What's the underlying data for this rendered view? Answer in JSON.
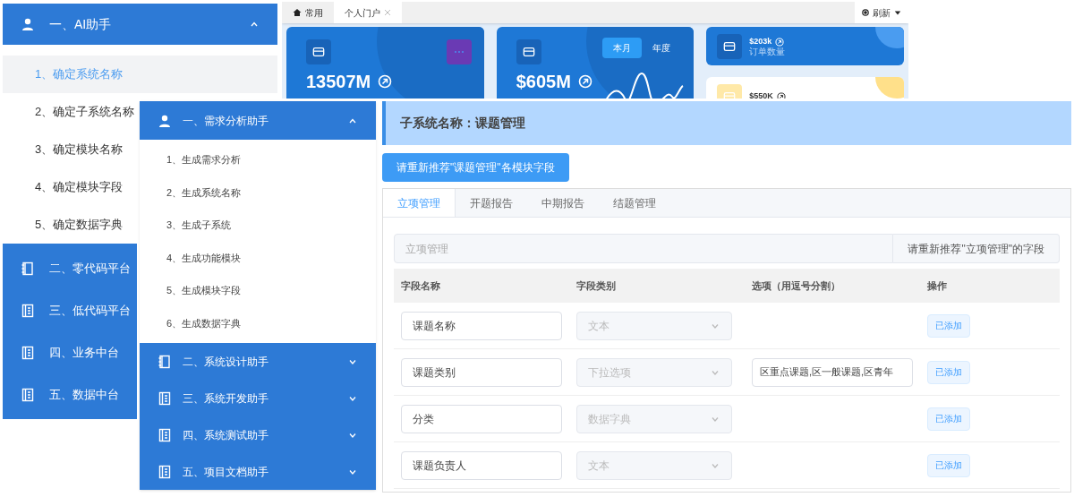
{
  "ai_menu": {
    "header": {
      "label": "一、AI助手",
      "expanded": true
    },
    "items": [
      {
        "label": "1、确定系统名称",
        "selected": true
      },
      {
        "label": "2、确定子系统名称",
        "selected": false
      },
      {
        "label": "3、确定模块名称",
        "selected": false
      },
      {
        "label": "4、确定模块字段",
        "selected": false
      },
      {
        "label": "5、确定数据字典",
        "selected": false
      }
    ],
    "sections": [
      {
        "label": "二、零代码平台",
        "kind": "notebook"
      },
      {
        "label": "三、低代码平台",
        "kind": "ledger"
      },
      {
        "label": "四、业务中台",
        "kind": "ledger"
      },
      {
        "label": "五、数据中台",
        "kind": "ledger"
      }
    ]
  },
  "dashboard": {
    "tabs": [
      {
        "label": "常用",
        "selected": false,
        "closable": false
      },
      {
        "label": "个人门户",
        "selected": true,
        "closable": true
      }
    ],
    "refresh": "刷新",
    "cards": [
      {
        "value": "13507M",
        "kind": "menu"
      },
      {
        "value": "$605M",
        "kind": "periods",
        "periods": [
          {
            "label": "本月",
            "selected": true
          },
          {
            "label": "年度",
            "selected": false
          }
        ]
      }
    ],
    "stats": [
      {
        "value": "$203k",
        "label": "订单数量",
        "kind": "blue"
      },
      {
        "value": "$550K",
        "kind": "white"
      }
    ]
  },
  "assistant_menu": {
    "header": {
      "label": "一、需求分析助手",
      "expanded": true
    },
    "items": [
      "1、生成需求分析",
      "2、生成系统名称",
      "3、生成子系统",
      "4、生成功能模块",
      "5、生成模块字段",
      "6、生成数据字典"
    ],
    "sections": [
      {
        "label": "二、系统设计助手",
        "kind": "notebook",
        "expanded": false
      },
      {
        "label": "三、系统开发助手",
        "kind": "ledger",
        "expanded": false
      },
      {
        "label": "四、系统测试助手",
        "kind": "ledger",
        "expanded": false
      },
      {
        "label": "五、项目文档助手",
        "kind": "ledger",
        "expanded": false
      }
    ]
  },
  "module_editor": {
    "title": "子系统名称：课题管理",
    "recommend_button": "请重新推荐\"课题管理\"各模块字段",
    "tabs": [
      {
        "label": "立项管理",
        "selected": true
      },
      {
        "label": "开题报告",
        "selected": false
      },
      {
        "label": "中期报告",
        "selected": false
      },
      {
        "label": "结题管理",
        "selected": false
      }
    ],
    "module_field": {
      "placeholder": "立项管理"
    },
    "module_button": "请重新推荐\"立项管理\"的字段",
    "columns": [
      "字段名称",
      "字段类别",
      "选项（用逗号分割）",
      "操作"
    ],
    "rows": [
      {
        "name": "课题名称",
        "type": "文本",
        "type_disabled": true,
        "action": "已添加"
      },
      {
        "name": "课题类别",
        "type": "下拉选项",
        "type_disabled": true,
        "options": "区重点课题,区一般课题,区青年",
        "action": "已添加"
      },
      {
        "name": "分类",
        "type": "数据字典",
        "type_disabled": true,
        "action": "已添加"
      },
      {
        "name": "课题负责人",
        "type": "文本",
        "type_disabled": true,
        "action": "已添加"
      }
    ]
  }
}
